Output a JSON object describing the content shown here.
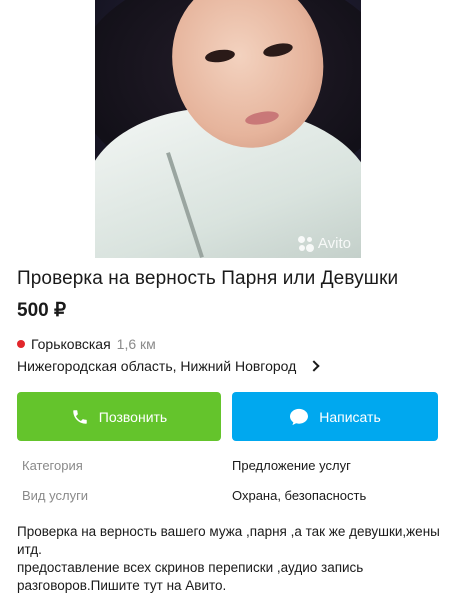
{
  "listing": {
    "photo_watermark": "Avito",
    "title": "Проверка на верность Парня или Девушки",
    "price": "500 ₽"
  },
  "location": {
    "metro_station": "Горьковская",
    "metro_distance": "1,6 км",
    "metro_color": "#e2262b",
    "region": "Нижегородская область, Нижний Новгород"
  },
  "actions": {
    "call_label": "Позвонить",
    "call_color": "#64c42c",
    "message_label": "Написать",
    "message_color": "#00a8ef"
  },
  "properties": [
    {
      "key": "Категория",
      "value": "Предложение услуг"
    },
    {
      "key": "Вид услуги",
      "value": "Охрана, безопасность"
    }
  ],
  "description": {
    "line1": "Проверка на верность вашего мужа ,парня ,а так же девушки,жены итд.",
    "line2": "предоставление всех скринов переписки ,аудио запись разговоров.Пишите тут на Авито."
  }
}
